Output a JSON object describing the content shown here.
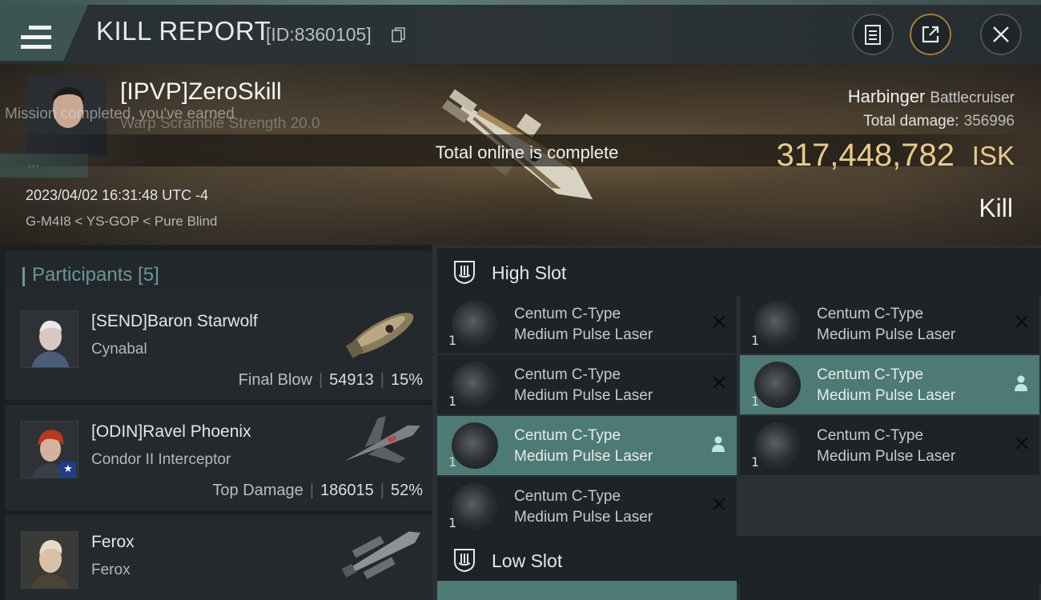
{
  "header": {
    "title": "KILL REPORT",
    "kill_id": "[ID:8360105]"
  },
  "victim": {
    "pilot": "[IPVP]ZeroSkill",
    "ghost_line_1": "Mission completed, you've earned",
    "ghost_line_2": "Warp Scramble Strength 20.0",
    "timestamp": "2023/04/02 16:31:48 UTC -4",
    "location": "G-M4I8 < YS-GOP < Pure Blind",
    "ship_name": "Harbinger",
    "ship_class": "Battlecruiser",
    "total_damage_label": "Total damage:",
    "total_damage": "356996",
    "isk_value": "317,448,782",
    "isk_unit": "ISK",
    "result": "Kill"
  },
  "toast": "Total online is complete",
  "participants": {
    "header": "Participants [5]",
    "rows": [
      {
        "name": "[SEND]Baron Starwolf",
        "ship": "Cynabal",
        "tag": "Final Blow",
        "damage": "54913",
        "percent": "15%"
      },
      {
        "name": "[ODIN]Ravel Phoenix",
        "ship": "Condor II Interceptor",
        "tag": "Top Damage",
        "damage": "186015",
        "percent": "52%"
      },
      {
        "name": "Ferox",
        "ship": "Ferox"
      }
    ]
  },
  "fitting": {
    "high_slot_label": "High Slot",
    "low_slot_label": "Low Slot",
    "modules": [
      {
        "line1": "Centum C-Type",
        "line2": "Medium Pulse Laser",
        "qty": "1",
        "state": "destroyed"
      },
      {
        "line1": "Centum C-Type",
        "line2": "Medium Pulse Laser",
        "qty": "1",
        "state": "destroyed"
      },
      {
        "line1": "Centum C-Type",
        "line2": "Medium Pulse Laser",
        "qty": "1",
        "state": "destroyed"
      },
      {
        "line1": "Centum C-Type",
        "line2": "Medium Pulse Laser",
        "qty": "1",
        "state": "dropped"
      },
      {
        "line1": "Centum C-Type",
        "line2": "Medium Pulse Laser",
        "qty": "1",
        "state": "dropped"
      },
      {
        "line1": "Centum C-Type",
        "line2": "Medium Pulse Laser",
        "qty": "1",
        "state": "destroyed"
      },
      {
        "line1": "Centum C-Type",
        "line2": "Medium Pulse Laser",
        "qty": "1",
        "state": "destroyed"
      }
    ]
  },
  "colors": {
    "accent_teal": "#4e7a75",
    "isk_gold": "#e8cb8a",
    "panel_dark": "#1d2326"
  }
}
